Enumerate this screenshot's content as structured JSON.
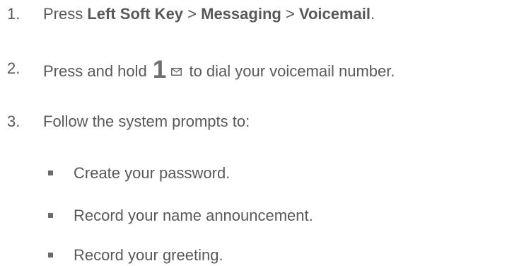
{
  "steps": [
    {
      "number": "1.",
      "parts": {
        "t1": "Press ",
        "b1": "Left Soft Key",
        "t2": " > ",
        "b2": "Messaging",
        "t3": " > ",
        "b3": "Voicemail",
        "t4": "."
      }
    },
    {
      "number": "2.",
      "parts": {
        "t1": "Press and hold ",
        "key": "1",
        "icon": "envelope-icon",
        "t2": " to dial your voicemail number."
      }
    },
    {
      "number": "3.",
      "text": "Follow the system prompts to:"
    }
  ],
  "substeps": [
    "Create your password.",
    "Record your name announcement.",
    "Record your greeting."
  ]
}
